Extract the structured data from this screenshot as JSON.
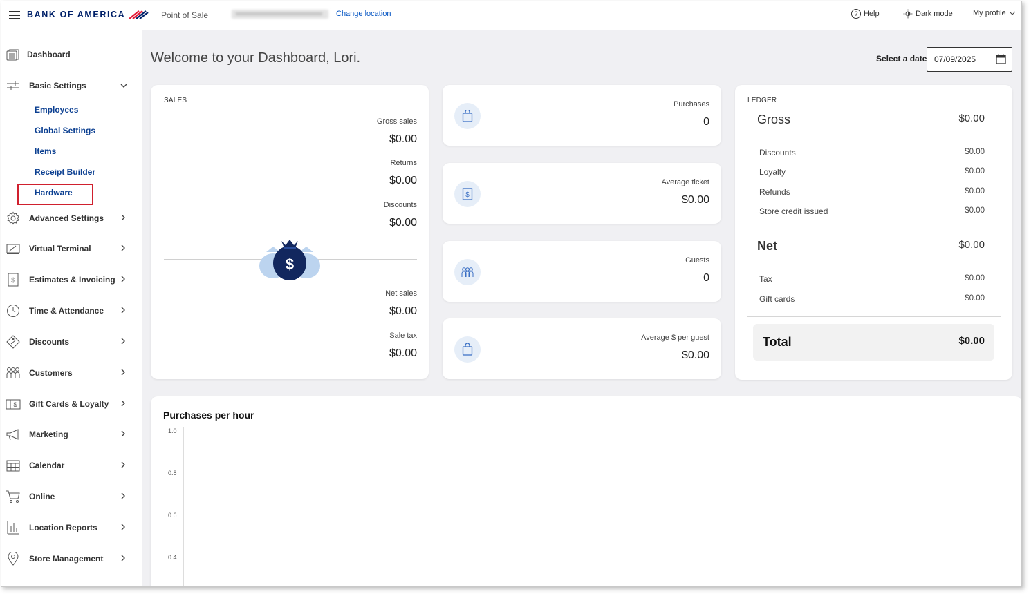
{
  "header": {
    "brand": "BANK OF AMERICA",
    "app_name": "Point of Sale",
    "change_location": "Change location",
    "help": "Help",
    "dark_mode": "Dark mode",
    "my_profile": "My profile"
  },
  "sidebar": {
    "dashboard": "Dashboard",
    "basic_settings": "Basic Settings",
    "basic_sub": [
      "Employees",
      "Global Settings",
      "Items",
      "Receipt Builder",
      "Hardware"
    ],
    "items": [
      {
        "label": "Advanced Settings",
        "icon": "gear-icon"
      },
      {
        "label": "Virtual Terminal",
        "icon": "terminal-icon"
      },
      {
        "label": "Estimates & Invoicing",
        "icon": "invoice-icon"
      },
      {
        "label": "Time & Attendance",
        "icon": "clock-icon"
      },
      {
        "label": "Discounts",
        "icon": "tag-icon"
      },
      {
        "label": "Customers",
        "icon": "people-icon"
      },
      {
        "label": "Gift Cards & Loyalty",
        "icon": "gift-card-icon"
      },
      {
        "label": "Marketing",
        "icon": "megaphone-icon"
      },
      {
        "label": "Calendar",
        "icon": "calendar-icon"
      },
      {
        "label": "Online",
        "icon": "cart-icon"
      },
      {
        "label": "Location Reports",
        "icon": "bar-chart-icon"
      },
      {
        "label": "Store Management",
        "icon": "location-pin-icon"
      }
    ]
  },
  "main": {
    "welcome": "Welcome to your Dashboard, Lori.",
    "date_label": "Select a date",
    "date_value": "07/09/2025",
    "sales": {
      "title": "SALES",
      "gross_sales_label": "Gross sales",
      "gross_sales": "$0.00",
      "returns_label": "Returns",
      "returns": "$0.00",
      "discounts_label": "Discounts",
      "discounts": "$0.00",
      "net_sales_label": "Net sales",
      "net_sales": "$0.00",
      "sale_tax_label": "Sale tax",
      "sale_tax": "$0.00"
    },
    "metrics": [
      {
        "label": "Purchases",
        "value": "0",
        "icon": "shopping-bag-icon"
      },
      {
        "label": "Average ticket",
        "value": "$0.00",
        "icon": "receipt-icon"
      },
      {
        "label": "Guests",
        "value": "0",
        "icon": "guests-icon"
      },
      {
        "label": "Average $ per guest",
        "value": "$0.00",
        "icon": "shopping-bag-icon"
      }
    ],
    "ledger": {
      "title": "LEDGER",
      "gross_label": "Gross",
      "gross": "$0.00",
      "rows1": [
        {
          "label": "Discounts",
          "value": "$0.00"
        },
        {
          "label": "Loyalty",
          "value": "$0.00"
        },
        {
          "label": "Refunds",
          "value": "$0.00"
        },
        {
          "label": "Store credit issued",
          "value": "$0.00"
        }
      ],
      "net_label": "Net",
      "net": "$0.00",
      "rows2": [
        {
          "label": "Tax",
          "value": "$0.00"
        },
        {
          "label": "Gift cards",
          "value": "$0.00"
        }
      ],
      "total_label": "Total",
      "total": "$0.00"
    },
    "purchases_chart": {
      "title": "Purchases per hour"
    }
  },
  "chart_data": {
    "type": "bar",
    "title": "Purchases per hour",
    "yticks": [
      "1.0",
      "0.8",
      "0.6",
      "0.4"
    ],
    "ylim": [
      0,
      1.0
    ],
    "series": []
  },
  "colors": {
    "brand_navy": "#012169",
    "brand_red": "#e31837",
    "link_blue": "#0b3f91",
    "highlight_red": "#d0202e"
  }
}
